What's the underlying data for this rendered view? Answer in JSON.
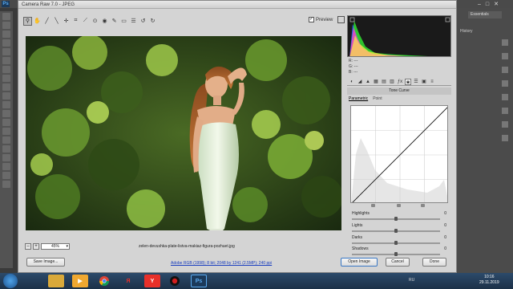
{
  "app": {
    "dialog_title": "Camera Raw 7.0  -  JPEG",
    "ps_logo": "Ps"
  },
  "ps_panel": {
    "essentials_label": "Essentials",
    "history_label": "History"
  },
  "toolbar": {
    "tools": [
      "zoom-tool",
      "hand-tool",
      "white-balance-tool",
      "color-sampler-tool",
      "targeted-adjustment-tool",
      "crop-tool",
      "straighten-tool",
      "spot-removal-tool",
      "red-eye-tool",
      "adjustment-brush-tool",
      "graduated-filter-tool",
      "preferences-tool",
      "rotate-ccw-tool",
      "rotate-cw-tool"
    ],
    "preview_label": "Preview",
    "preview_checked": true
  },
  "image": {
    "zoom_value": "45%",
    "filename": "zelen-devushka-plate-listva-makiaz-figura-pozhuet.jpg"
  },
  "histogram": {
    "r_label": "R:",
    "g_label": "G:",
    "b_label": "B:",
    "r_value": "---",
    "g_value": "---",
    "b_value": "---"
  },
  "panel": {
    "title": "Tone Curve",
    "subtabs": [
      "Parametric",
      "Point"
    ],
    "active_subtab": "Parametric"
  },
  "sliders": [
    {
      "label": "Highlights",
      "value": "0",
      "position": 0.5
    },
    {
      "label": "Lights",
      "value": "0",
      "position": 0.5
    },
    {
      "label": "Darks",
      "value": "0",
      "position": 0.5
    },
    {
      "label": "Shadows",
      "value": "0",
      "position": 0.5
    }
  ],
  "footer": {
    "save_image_label": "Save Image...",
    "workflow_info": "Adobe RGB (1998); 8 bit; 2048 by 1241 (2.5MP); 240 ppi",
    "open_image_label": "Open Image",
    "cancel_label": "Cancel",
    "done_label": "Done"
  },
  "taskbar": {
    "language": "RU",
    "time": "10:16",
    "date": "29.11.2019",
    "pinned": [
      "explorer-icon",
      "media-player-icon",
      "chrome-icon",
      "yandex-browser-icon",
      "yandex-icon",
      "record-icon",
      "photoshop-icon"
    ]
  },
  "colors": {
    "accent": "#3a78c4",
    "dialog_bg": "#d4d4d4",
    "taskbar": "#1c3148"
  }
}
